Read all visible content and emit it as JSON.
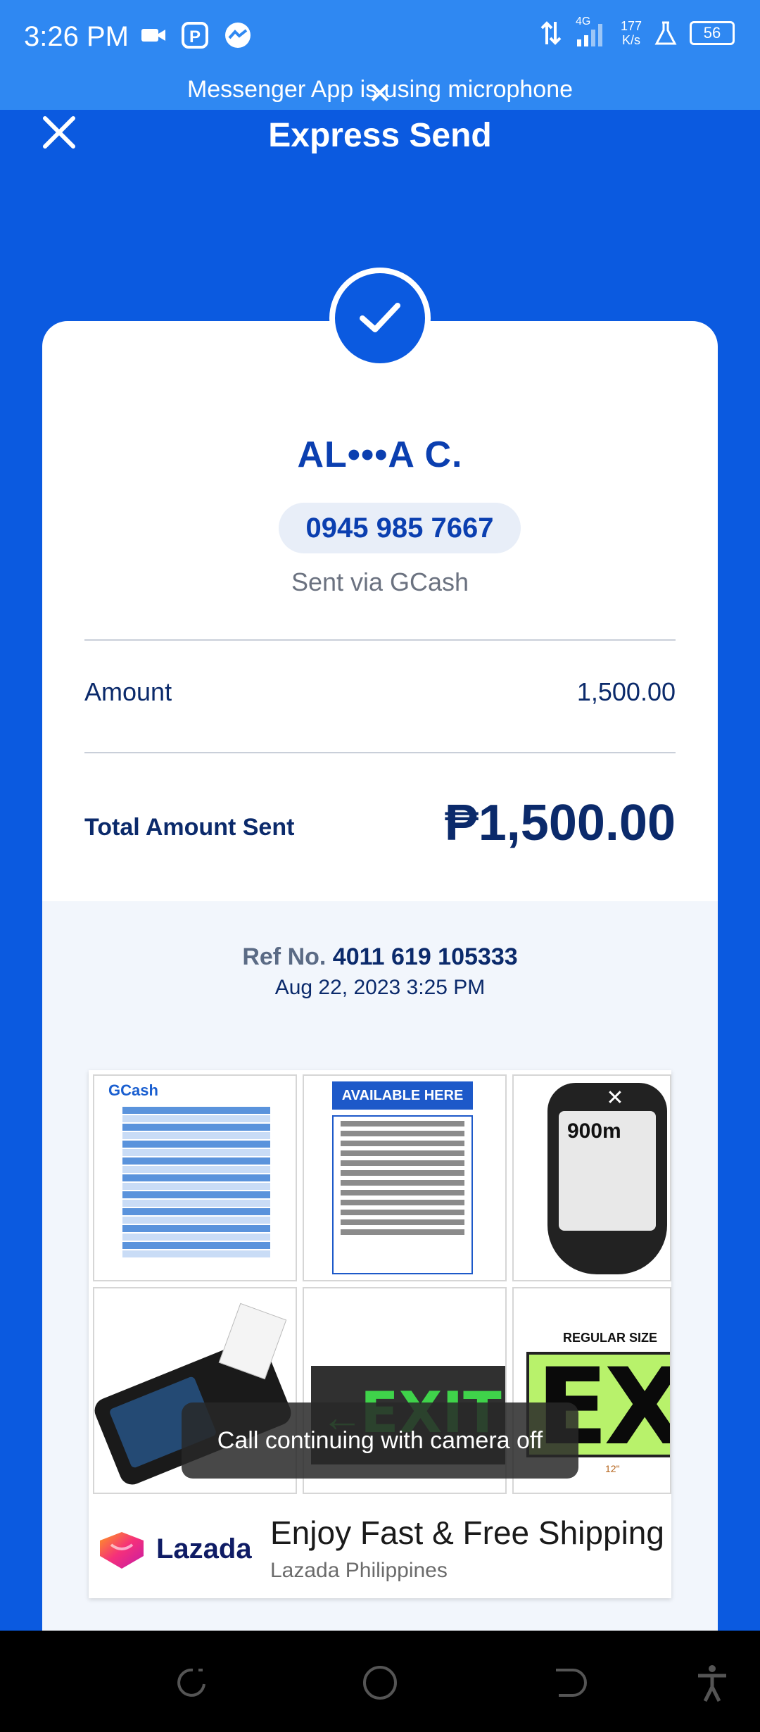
{
  "status_bar": {
    "time": "3:26 PM",
    "network_type": "4G",
    "speed_value": "177",
    "speed_unit": "K/s",
    "battery": "56"
  },
  "mic_banner": {
    "text": "Messenger App is using microphone"
  },
  "header": {
    "title": "Express Send"
  },
  "receipt": {
    "recipient_name": "AL•••A C.",
    "phone_number": "0945 985 7667",
    "sent_via": "Sent via GCash",
    "amount_label": "Amount",
    "amount_value": "1,500.00",
    "total_label": "Total Amount Sent",
    "total_value": "₱1,500.00",
    "ref_label": "Ref No.",
    "ref_number": "4011 619 105333",
    "date": "Aug 22, 2023 3:25 PM"
  },
  "ad": {
    "tile1_title": "GCash",
    "tile2_title": "AVAILABLE HERE",
    "tile3_readout": "900m",
    "tile6_caption": "REGULAR SIZE",
    "tile5_text": "EXIT",
    "tile6_text": "EXIT",
    "tile6_dimension": "12\"",
    "brand_name": "Lazada",
    "headline": "Enjoy Fast & Free Shipping",
    "advertiser": "Lazada Philippines"
  },
  "toast": {
    "text": "Call continuing with camera off"
  },
  "colors": {
    "brand_blue": "#0b5ae0",
    "status_bar_blue": "#2f88f2",
    "text_navy": "#0b2a6b"
  }
}
